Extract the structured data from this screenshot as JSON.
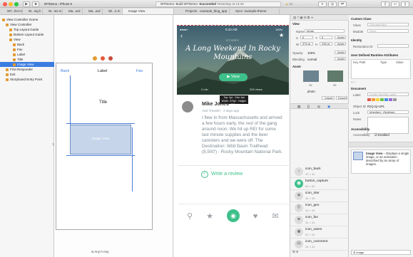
{
  "titlebar": {
    "scheme": "WTDemo",
    "device": "iPhone 6",
    "status_prefix": "WTDemo: Build WTDemo:",
    "status_result": "Succeeded",
    "status_time": "Yesterday at 13:40",
    "issue_count": "12"
  },
  "tabs": [
    "WT...ller.m",
    "W...ing.h",
    "W...ins.m",
    "Ma...ard",
    "Ma...ard",
    "Wi...e.m",
    "Image View",
    "Projects · example_blog_app",
    "Sync: example-theme"
  ],
  "navigator": {
    "items": [
      {
        "label": "View Controller Scene",
        "indent": 0,
        "selected": false
      },
      {
        "label": "View Controller",
        "indent": 1,
        "selected": false
      },
      {
        "label": "Top Layout Guide",
        "indent": 2,
        "selected": false
      },
      {
        "label": "Bottom Layout Guide",
        "indent": 2,
        "selected": false
      },
      {
        "label": "View",
        "indent": 2,
        "selected": false
      },
      {
        "label": "Back",
        "indent": 3,
        "selected": false
      },
      {
        "label": "Fav",
        "indent": 3,
        "selected": false
      },
      {
        "label": "Label",
        "indent": 3,
        "selected": false
      },
      {
        "label": "Title",
        "indent": 3,
        "selected": false
      },
      {
        "label": "Image View",
        "indent": 3,
        "selected": true
      },
      {
        "label": "First Responder",
        "indent": 1,
        "selected": false
      },
      {
        "label": "Exit",
        "indent": 1,
        "selected": false
      },
      {
        "label": "Storyboard Entry Point",
        "indent": 1,
        "selected": false
      }
    ]
  },
  "scene": {
    "back": "Back",
    "label": "Label",
    "fav": "Fav",
    "title": "Title",
    "image_view": "Image View",
    "size_class": "w Any  h Any"
  },
  "preview": {
    "status_time": "5:10 AM",
    "status_battery": "100%",
    "story_tag": "STORY",
    "hero_title": "A Long Weekend In Rocky Mountains",
    "view_button": "View",
    "stat_left": "2 min",
    "stat_right": "209 views",
    "tooltip_lines": [
      "Top: 0pt · Dist: 0pt",
      "Width: 375pt · Height: 236pt"
    ],
    "author_name": "Mike Jones",
    "author_role": "Avid Traveler · 2 days ago",
    "body": "I flew in from Massachusetts and arrived a few hours early, the rest of the gang around noon. We hit up REI for some last minute supplies and the beer canisters and we were off. The Destination: Wild Basin Trailhead (8,500') - Rocky Mountain National Park.",
    "review_label": "Write a review"
  },
  "inspector": {
    "header": "View",
    "name_label": "Name",
    "name_value": "photo",
    "x_label": "X",
    "x_value": "0",
    "y_label": "Y",
    "y_value": "0",
    "w_label": "W",
    "w_value": "375 pt",
    "h_label": "H",
    "h_value": "236 pt",
    "opacity_label": "Opacity",
    "opacity_value": "100%",
    "blending_label": "Blending",
    "blending_value": "normal",
    "apply": "Apply",
    "asset_label": "Asset",
    "asset_value": "photo",
    "import_label": "Import",
    "export_label": "Export",
    "asset_files": [
      "1x",
      "2x"
    ],
    "custom_class_header": "Custom Class",
    "class_label": "Class",
    "class_placeholder": "UIImageView",
    "module_label": "Module",
    "module_value": "None",
    "identity_header": "Identity",
    "restoration_label": "Restoration ID",
    "runtime_header": "User Defined Runtime Attributes",
    "runtime_cols": [
      "Key Path",
      "Type",
      "Value"
    ],
    "document_header": "Document",
    "doc_label": "Label",
    "doc_label_placeholder": "Xcode Specific Label",
    "object_id_label": "Object ID",
    "object_id_value": "RzQ-zp-UPL",
    "lock_label": "Lock",
    "lock_value": "Inherited - (Nothing)",
    "notes_label": "Notes",
    "accessibility_header": "Accessibility",
    "accessibility_label": "Accessibility",
    "accessibility_value": "Enabled"
  },
  "library": {
    "items": [
      {
        "name": "icon_back",
        "size": "32 × 40",
        "icon": "‹",
        "color": "#dddddd"
      },
      {
        "name": "button_capture",
        "size": "64 × 64",
        "icon": "◉",
        "color": "#3ec08a"
      },
      {
        "name": "icon_star",
        "size": "34 × 34",
        "icon": "★",
        "color": "#dddddd"
      },
      {
        "name": "icon_geo",
        "size": "34 × 42",
        "icon": "⚲",
        "color": "#dddddd"
      },
      {
        "name": "icon_fav",
        "size": "34 × 34",
        "icon": "♥",
        "color": "#dddddd"
      },
      {
        "name": "icon_users",
        "size": "52 × 34",
        "icon": "☻",
        "color": "#dddddd"
      },
      {
        "name": "icon_comment",
        "size": "34 × 34",
        "icon": "✉",
        "color": "#dddddd"
      }
    ]
  },
  "quickhelp": {
    "title": "Image View",
    "description": "Displays a single image, or an animation described by an array of images.",
    "filter_placeholder": "image"
  },
  "colors": {
    "accent_green": "#3ec08a",
    "selection_blue": "#3b7ce0",
    "constraint_blue": "#4a7fd6"
  }
}
